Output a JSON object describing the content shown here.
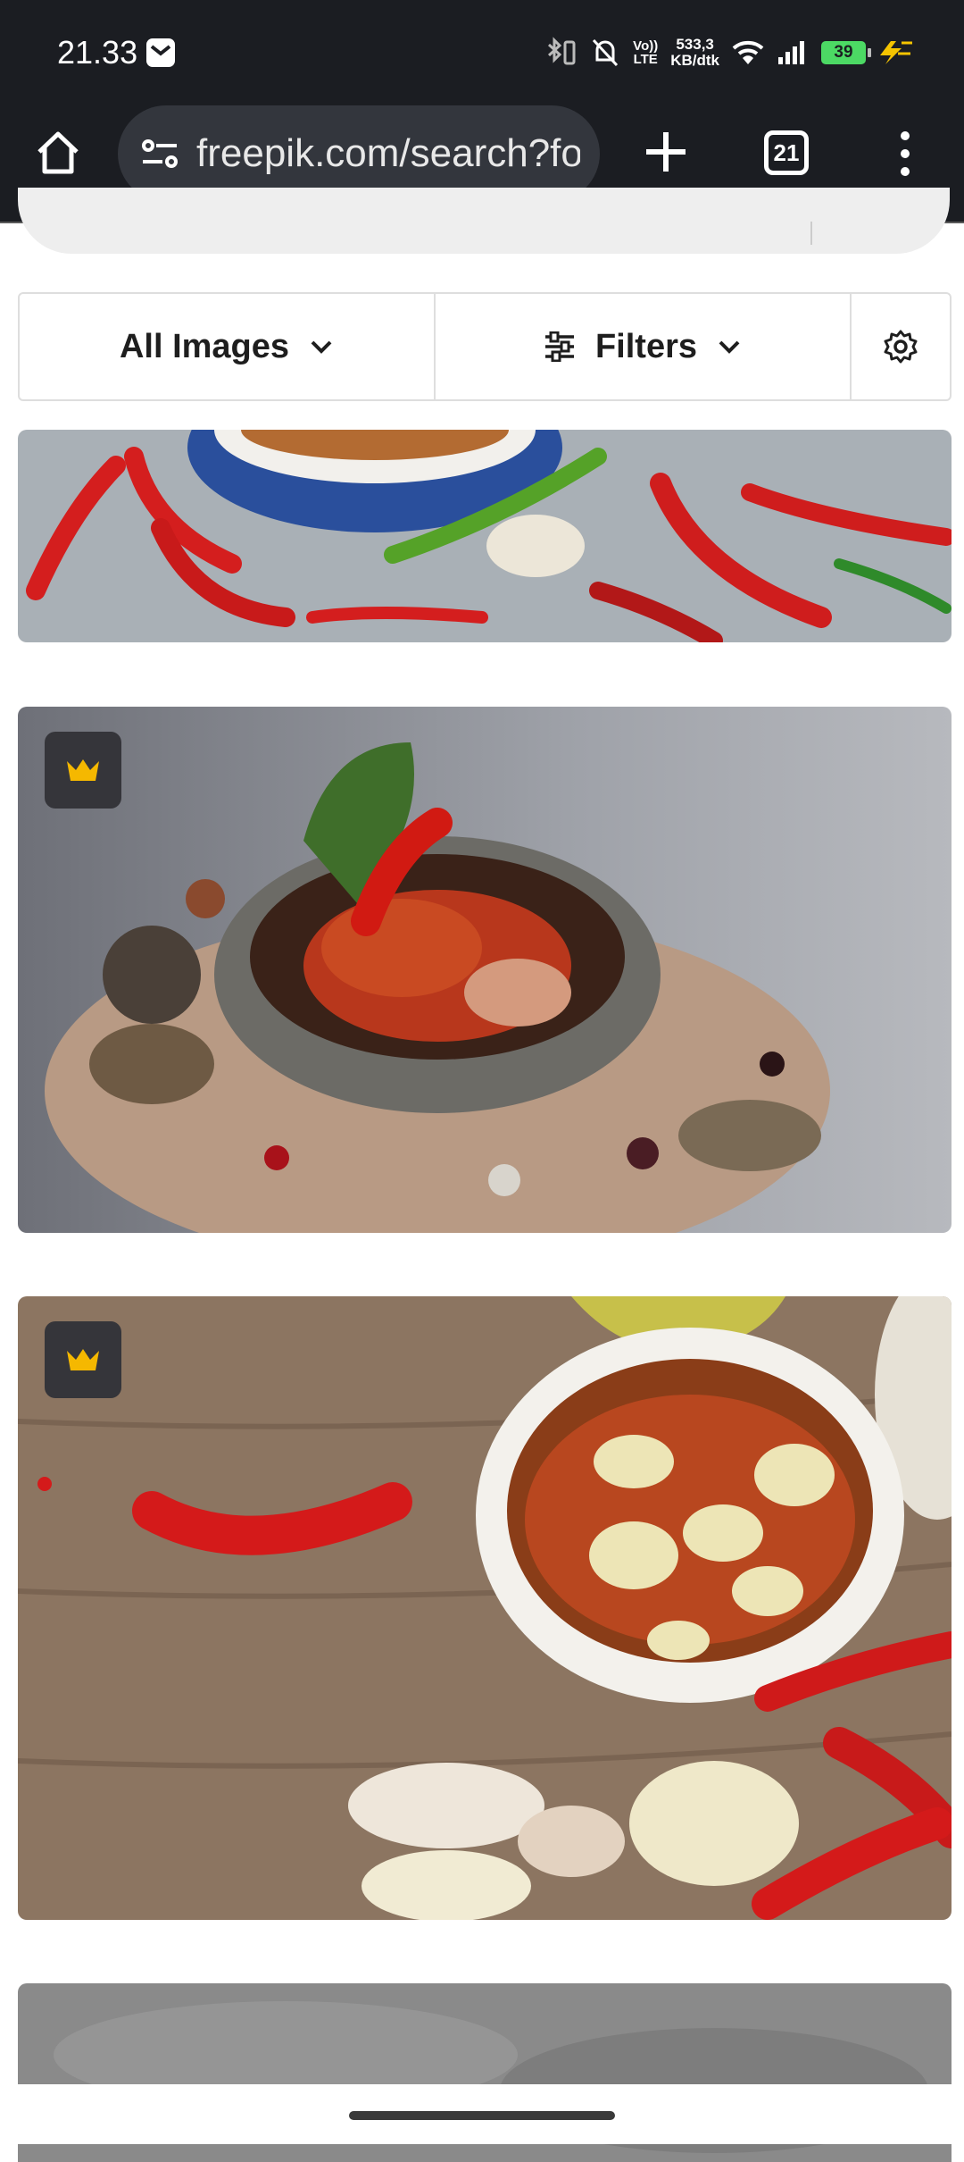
{
  "status_bar": {
    "time": "21.33",
    "net_speed_value": "533,3",
    "net_speed_unit": "KB/dtk",
    "lte_top": "Vo))",
    "lte_bottom": "LTE",
    "battery_level": "39",
    "icons": [
      "gmail-notification-icon",
      "bluetooth-icon",
      "mute-icon",
      "wifi-icon",
      "signal-icon",
      "charging-icon"
    ]
  },
  "browser": {
    "url": "freepik.com/search?format",
    "tab_count": "21"
  },
  "filters": {
    "all_images_label": "All Images",
    "filters_label": "Filters"
  },
  "images": [
    {
      "subject": "red-chilies-bowl",
      "premium": false
    },
    {
      "subject": "sambal-mortar",
      "premium": true
    },
    {
      "subject": "chili-fish-sauce-bowl",
      "premium": true
    },
    {
      "subject": "grey-texture",
      "premium": false
    }
  ],
  "colors": {
    "chrome_background": "#1b1d22",
    "url_bar": "#33363d",
    "premium_crown": "#f5b800",
    "premium_badge": "#35353a"
  }
}
